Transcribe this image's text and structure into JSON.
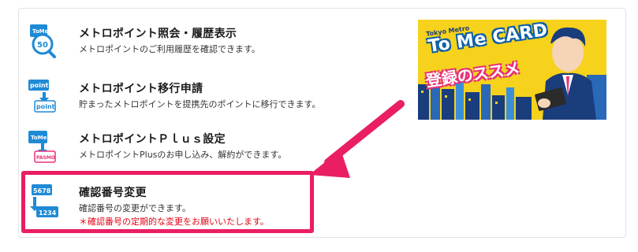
{
  "menu": {
    "items": [
      {
        "title": "メトロポイント照会・履歴表示",
        "description": "メトロポイントのご利用履歴を確認できます。",
        "icon": "tome-50-points-icon"
      },
      {
        "title": "メトロポイント移行申請",
        "description": "貯まったメトロポイントを提携先のポイントに移行できます。",
        "icon": "point-transfer-icon"
      },
      {
        "title": "メトロポイントＰｌｕｓ設定",
        "description": "メトロポイントPlusのお申し込み、解約ができます。",
        "icon": "tome-pasmo-card-icon"
      },
      {
        "title": "確認番号変更",
        "description": "確認番号の変更ができます。",
        "note": "＊確認番号の定期的な変更をお願いいたします。",
        "icon": "security-number-change-icon"
      }
    ]
  },
  "banner": {
    "small_text": "Tokyo Metro",
    "title": "To Me CARD",
    "subtitle": "登録のススメ",
    "background": "#f6d21c"
  },
  "colors": {
    "highlight": "#e91e63",
    "note": "#e50012",
    "icon_blue": "#1f8ad6"
  }
}
